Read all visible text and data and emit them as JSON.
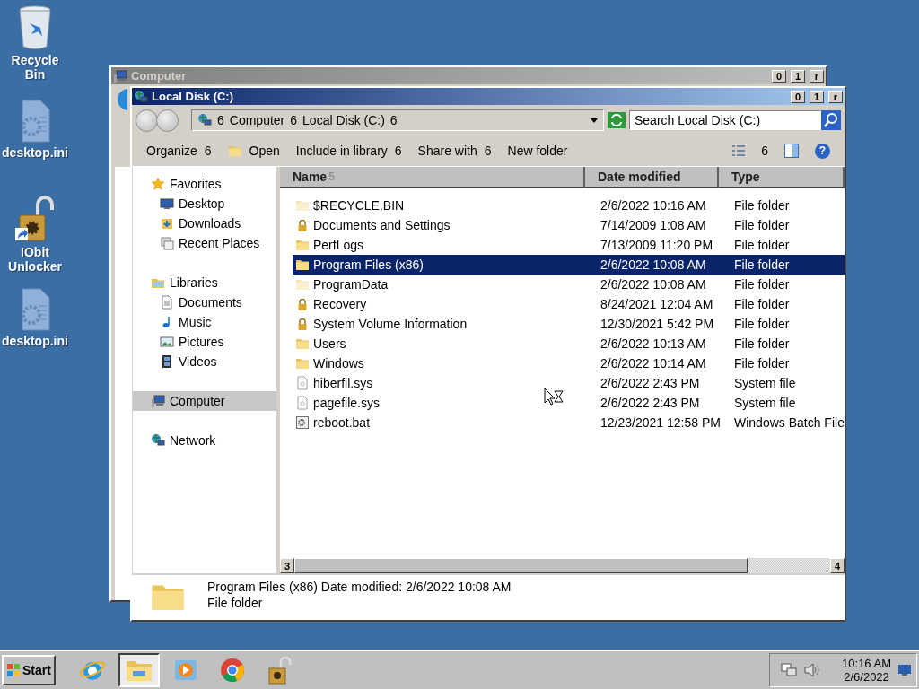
{
  "desktop_icons": [
    {
      "label": "Recycle Bin",
      "kind": "recycle"
    },
    {
      "label": "desktop.ini",
      "kind": "file"
    },
    {
      "label": "IObit Unlocker",
      "kind": "unlocker"
    },
    {
      "label": "desktop.ini",
      "kind": "file"
    }
  ],
  "background_window": {
    "title": "Computer",
    "caption_buttons": [
      "0",
      "1",
      "r"
    ]
  },
  "window": {
    "title": "Local Disk (C:)",
    "caption_buttons": [
      "0",
      "1",
      "r"
    ],
    "address": [
      "6",
      "Computer",
      "6",
      "Local Disk (C:)",
      "6"
    ],
    "search": {
      "placeholder": "Search Local Disk (C:)"
    },
    "toolbar": [
      {
        "label": "Organize",
        "caret": "6",
        "kind": "menu"
      },
      {
        "label": "Open",
        "kind": "open"
      },
      {
        "label": "Include in library",
        "caret": "6",
        "kind": "menu"
      },
      {
        "label": "Share with",
        "caret": "6",
        "kind": "menu"
      },
      {
        "label": "New folder",
        "kind": "plain"
      }
    ],
    "view_caret": "6",
    "help": "?",
    "sidebar": [
      {
        "label": "Favorites",
        "kind": "star",
        "selected": false,
        "children": [
          {
            "label": "Desktop",
            "kind": "desktop",
            "selected": false
          },
          {
            "label": "Downloads",
            "kind": "downloads",
            "selected": false
          },
          {
            "label": "Recent Places",
            "kind": "recent",
            "selected": false
          }
        ]
      },
      {
        "label": "Libraries",
        "kind": "libraries",
        "selected": false,
        "children": [
          {
            "label": "Documents",
            "kind": "documents",
            "selected": false
          },
          {
            "label": "Music",
            "kind": "music",
            "selected": false
          },
          {
            "label": "Pictures",
            "kind": "pictures",
            "selected": false
          },
          {
            "label": "Videos",
            "kind": "videos",
            "selected": false
          }
        ]
      },
      {
        "label": "Computer",
        "kind": "computer",
        "selected": true
      },
      {
        "label": "Network",
        "kind": "network",
        "selected": false
      }
    ],
    "columns": [
      {
        "label": "Name",
        "sort": "5"
      },
      {
        "label": "Date modified"
      },
      {
        "label": "Type"
      }
    ],
    "rows": [
      {
        "name": "$RECYCLE.BIN",
        "date": "2/6/2022 10:16 AM",
        "type": "File folder",
        "kind": "hidden-folder",
        "selected": false
      },
      {
        "name": "Documents and Settings",
        "date": "7/14/2009 1:08 AM",
        "type": "File folder",
        "kind": "locked",
        "selected": false
      },
      {
        "name": "PerfLogs",
        "date": "7/13/2009 11:20 PM",
        "type": "File folder",
        "kind": "folder",
        "selected": false
      },
      {
        "name": "Program Files (x86)",
        "date": "2/6/2022 10:08 AM",
        "type": "File folder",
        "kind": "folder",
        "selected": true
      },
      {
        "name": "ProgramData",
        "date": "2/6/2022 10:08 AM",
        "type": "File folder",
        "kind": "hidden-folder",
        "selected": false
      },
      {
        "name": "Recovery",
        "date": "8/24/2021 12:04 AM",
        "type": "File folder",
        "kind": "locked",
        "selected": false
      },
      {
        "name": "System Volume Information",
        "date": "12/30/2021 5:42 PM",
        "type": "File folder",
        "kind": "locked",
        "selected": false
      },
      {
        "name": "Users",
        "date": "2/6/2022 10:13 AM",
        "type": "File folder",
        "kind": "folder",
        "selected": false
      },
      {
        "name": "Windows",
        "date": "2/6/2022 10:14 AM",
        "type": "File folder",
        "kind": "folder",
        "selected": false
      },
      {
        "name": "hiberfil.sys",
        "date": "2/6/2022 2:43 PM",
        "type": "System file",
        "kind": "sysfile",
        "selected": false
      },
      {
        "name": "pagefile.sys",
        "date": "2/6/2022 2:43 PM",
        "type": "System file",
        "kind": "sysfile",
        "selected": false
      },
      {
        "name": "reboot.bat",
        "date": "12/23/2021 12:58 PM",
        "type": "Windows Batch File",
        "kind": "bat",
        "selected": false
      }
    ],
    "scroll_arrows": [
      "3",
      "4"
    ],
    "details": {
      "line1": "Program Files (x86) Date modified: 2/6/2022 10:08 AM",
      "line2": "File folder"
    }
  },
  "taskbar": {
    "start": "Start",
    "apps": [
      {
        "kind": "ie",
        "selected": false
      },
      {
        "kind": "explorer",
        "selected": true
      },
      {
        "kind": "media",
        "selected": false
      },
      {
        "kind": "chrome",
        "selected": false
      },
      {
        "kind": "unlocker",
        "selected": false
      }
    ],
    "time": "10:16 AM",
    "date": "2/6/2022"
  }
}
